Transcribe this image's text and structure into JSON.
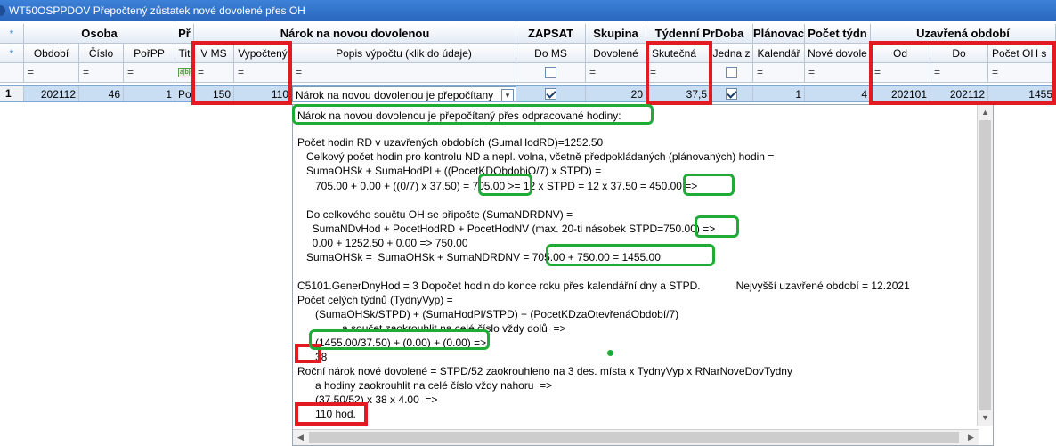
{
  "window": {
    "title": "WT50OSPPDOV Přepočtený zůstatek nové dovolené přes OH"
  },
  "groups": {
    "star": "*",
    "osoba": "Osoba",
    "pr": "Př",
    "narok": "Nárok na novou dovolenou",
    "zapsat": "ZAPSAT",
    "skupina": "Skupina",
    "tydenni": "Týdenní PrDoba",
    "planovac": "Plánovac",
    "pocet_tydnu": "Počet týdn",
    "uzavrena": "Uzavřená období"
  },
  "columns": {
    "star": "*",
    "obdobi": "Období",
    "cislo": "Číslo",
    "porpp": "PořPP",
    "tit": "Tit",
    "v_ms": "V MS",
    "vypocteny": "Vypočtený",
    "popis": "Popis výpočtu (klik do údaje)",
    "do_ms": "Do MS",
    "dovolene": "Dovolené",
    "skutecna": "Skutečná",
    "jedna_z": "Jedna z",
    "kalendar": "Kalendář",
    "nove_dovole": "Nové dovole",
    "od": "Od",
    "do": "Do",
    "pocet_oh": "Počet OH s"
  },
  "filter": {
    "eq": "=",
    "tit_icon": "a|b|c"
  },
  "row": {
    "index": "1",
    "obdobi": "202112",
    "cislo": "46",
    "porpp": "1",
    "tit": "Po",
    "v_ms": "150",
    "vypocteny": "110",
    "popis": "Nárok na novou dovolenou je přepočítany",
    "dovolene": "20",
    "skutecna": "37,5",
    "kalendar": "1",
    "nove_dovole": "4",
    "od": "202101",
    "do": "202112",
    "pocet_oh": "1455",
    "do_ms_checked": true,
    "jedna_z_checked": true
  },
  "popup": {
    "lines": [
      "Nárok na novou dovolenou je přepočítaný přes odpracované hodiny:",
      "Počet hodin RD v uzavřených obdobích (SumaHodRD)=1252.50",
      "   Celkový počet hodin pro kontrolu ND a nepl. volna, včetně předpokládaných (plánovaných) hodin =",
      "   SumaOHSk + SumaHodPl + ((PocetKDObdobiO/7) x STPD) =",
      "      705.00 + 0.00 + ((0/7) x 37.50) = 705.00 >= 12 x STPD = 12 x 37.50 = 450.00 =>",
      "   Do celkového součtu OH se připočte (SumaNDRDNV) =",
      "     SumaNDvHod + PocetHodRD + PocetHodNV (max. 20-ti násobek STPD=750.00) =>",
      "     0.00 + 1252.50 + 0.00 => 750.00",
      "   SumaOHSk =  SumaOHSk + SumaNDRDNV = 705.00 + 750.00 = 1455.00",
      "C5101.GenerDnyHod = 3 Dopočet hodin do konce roku přes kalendářní dny a STPD.            Nejvyšší uzavřené období = 12.2021",
      "Počet celých týdnů (TydnyVyp) =",
      "      (SumaOHSk/STPD) + (SumaHodPl/STPD) + (PocetKDzaOtevřenáObdobí/7)",
      "               a součet zaokrouhlit na celé číslo vždy dolů  =>",
      "      (1455.00/37.50) + (0.00) + (0.00) =>",
      "      38",
      "Roční nárok nové dovolené = STPD/52 zaokrouhleno na 3 des. místa x TydnyVyp x RNarNoveDovTydny",
      "      a hodiny zaokrouhlit na celé číslo vždy nahoru  =>",
      "      (37.50/52) x 38 x 4.00  =>",
      "      110 hod."
    ]
  },
  "colors": {
    "title_bar": "#2f70c9",
    "selected_row": "#c9ddf3",
    "annotation_red": "#e21b23",
    "annotation_green": "#1fab35"
  }
}
